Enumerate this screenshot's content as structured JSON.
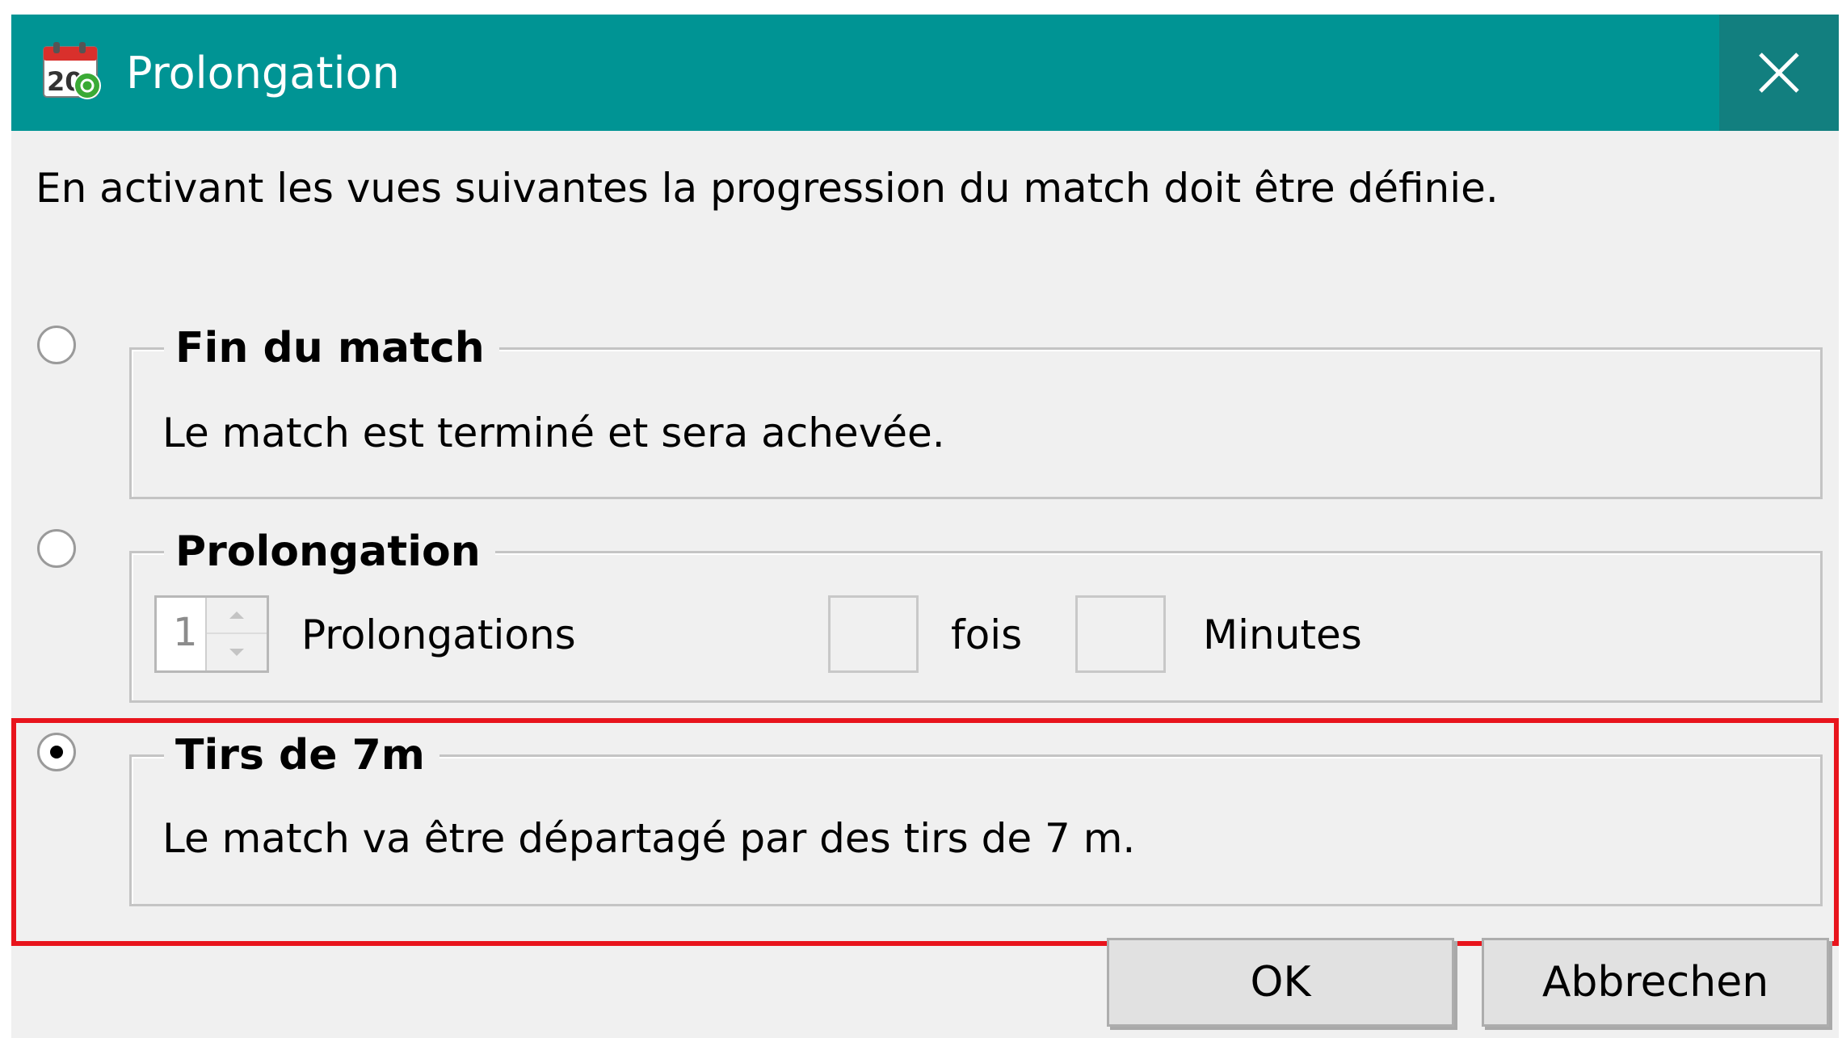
{
  "window": {
    "title": "Prolongation",
    "app_icon": "calendar-icon",
    "app_icon_text": "20",
    "close_icon": "close-icon",
    "titlebar_color": "#009494"
  },
  "intro_text": "En activant les vues suivantes la progression du match doit être définie.",
  "options": {
    "end_match": {
      "title": "Fin du match",
      "description": "Le match est terminé et sera achevée.",
      "selected": false
    },
    "overtime": {
      "title": "Prolongation",
      "count_value": "1",
      "count_label": "Prolongations",
      "times_value": "",
      "times_label": "fois",
      "minutes_value": "",
      "minutes_label": "Minutes",
      "selected": false
    },
    "penalties": {
      "title": "Tirs de 7m",
      "description": "Le match va être départagé par des tirs de 7 m.",
      "selected": true
    }
  },
  "highlight_color": "#e8141c",
  "buttons": {
    "ok": "OK",
    "cancel": "Abbrechen"
  }
}
